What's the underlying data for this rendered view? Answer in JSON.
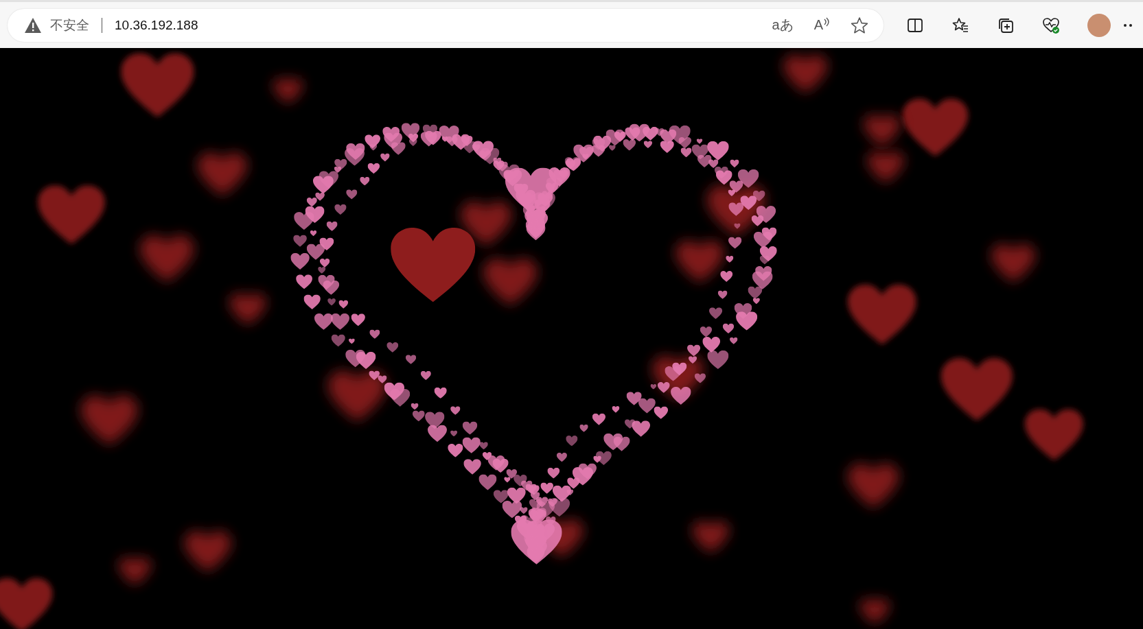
{
  "address_bar": {
    "security_label": "不安全",
    "url": "10.36.192.188",
    "translate_glyph": "aあ",
    "read_aloud_glyph": "A"
  }
}
